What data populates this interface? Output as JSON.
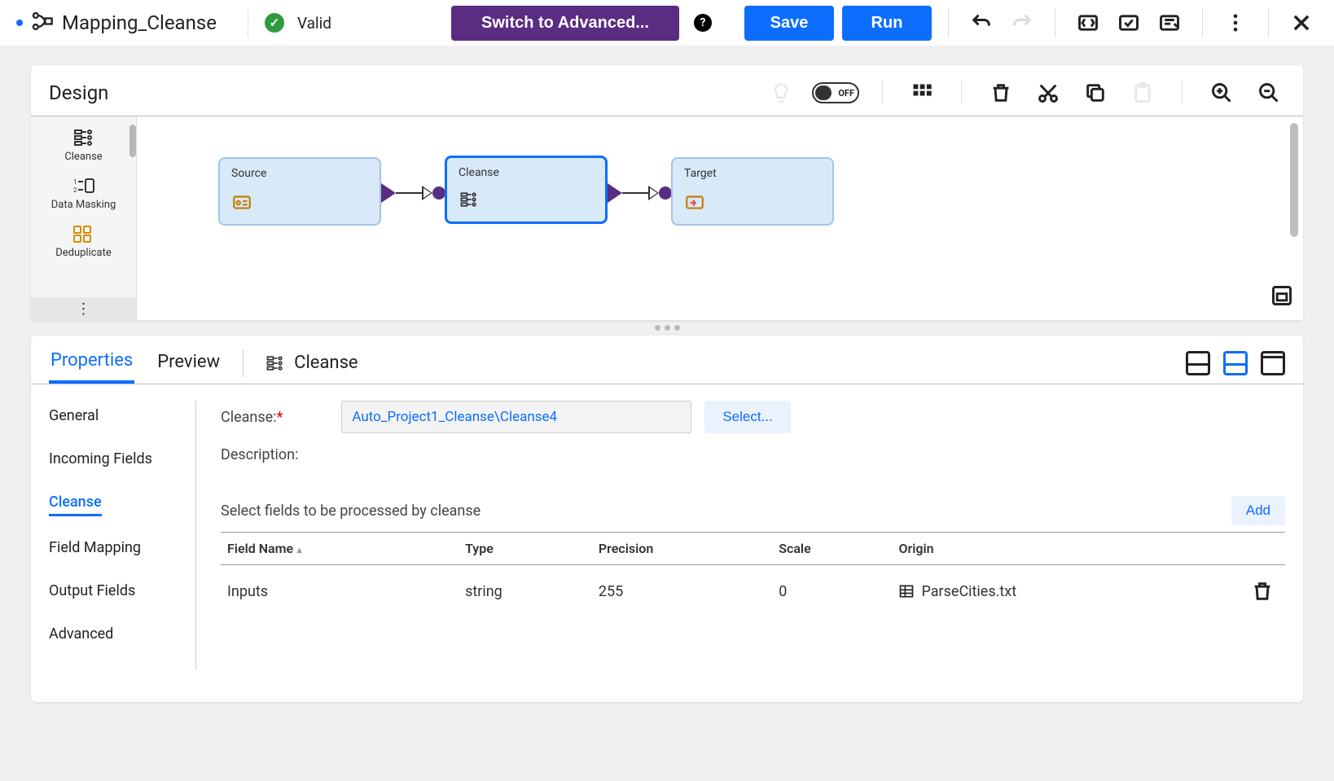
{
  "header": {
    "title": "Mapping_Cleanse",
    "valid_label": "Valid",
    "switch_advanced": "Switch to Advanced...",
    "save": "Save",
    "run": "Run"
  },
  "design": {
    "title": "Design",
    "off_label": "OFF",
    "palette": [
      {
        "label": "Cleanse"
      },
      {
        "label": "Data Masking"
      },
      {
        "label": "Deduplicate"
      }
    ],
    "nodes": {
      "source": "Source",
      "cleanse": "Cleanse",
      "target": "Target"
    }
  },
  "props": {
    "tabs": {
      "properties": "Properties",
      "preview": "Preview"
    },
    "context_label": "Cleanse",
    "sidenav": [
      "General",
      "Incoming Fields",
      "Cleanse",
      "Field Mapping",
      "Output Fields",
      "Advanced"
    ],
    "cleanse_label": "Cleanse:",
    "cleanse_value": "Auto_Project1_Cleanse\\Cleanse4",
    "select_btn": "Select...",
    "description_label": "Description:",
    "table_inst": "Select fields to be processed by cleanse",
    "add_btn": "Add",
    "columns": {
      "field_name": "Field Name",
      "type": "Type",
      "precision": "Precision",
      "scale": "Scale",
      "origin": "Origin"
    },
    "row": {
      "field_name": "Inputs",
      "type": "string",
      "precision": "255",
      "scale": "0",
      "origin": "ParseCities.txt"
    }
  }
}
